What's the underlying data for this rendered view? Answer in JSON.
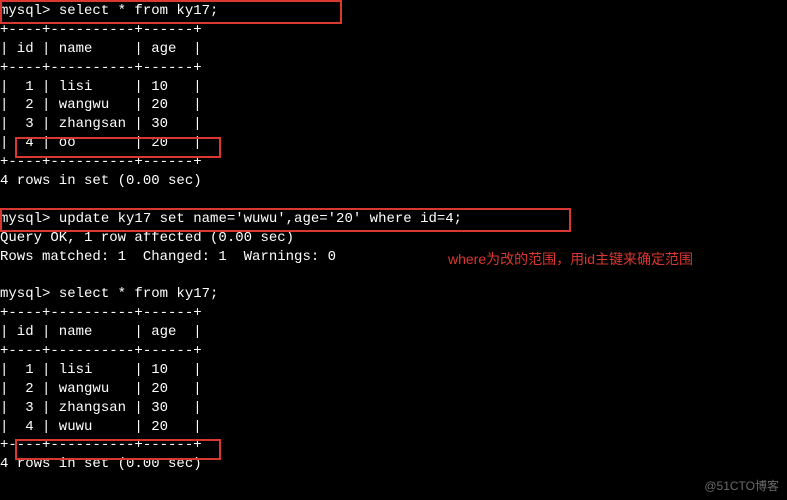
{
  "prompt": "mysql> ",
  "queries": {
    "select1": "select * from ky17;",
    "update": "update ky17 set name='wuwu',age='20' where id=4;",
    "select2": "select * from ky17;"
  },
  "table1": {
    "border": "+----+----------+------+",
    "header": "| id | name     | age  |",
    "rows": [
      "|  1 | lisi     | 10   |",
      "|  2 | wangwu   | 20   |",
      "|  3 | zhangsan | 30   |",
      "|  4 | oo       | 20   |"
    ],
    "footer": "4 rows in set (0.00 sec)"
  },
  "update_result": {
    "l1": "Query OK, 1 row affected (0.00 sec)",
    "l2": "Rows matched: 1  Changed: 1  Warnings: 0"
  },
  "table2": {
    "border": "+----+----------+------+",
    "header": "| id | name     | age  |",
    "rows": [
      "|  1 | lisi     | 10   |",
      "|  2 | wangwu   | 20   |",
      "|  3 | zhangsan | 30   |",
      "|  4 | wuwu     | 20   |"
    ],
    "footer": "4 rows in set (0.00 sec)"
  },
  "annotation": "where为改的范围，用id主键来确定范围",
  "watermark": "@51CTO博客",
  "blank": " "
}
